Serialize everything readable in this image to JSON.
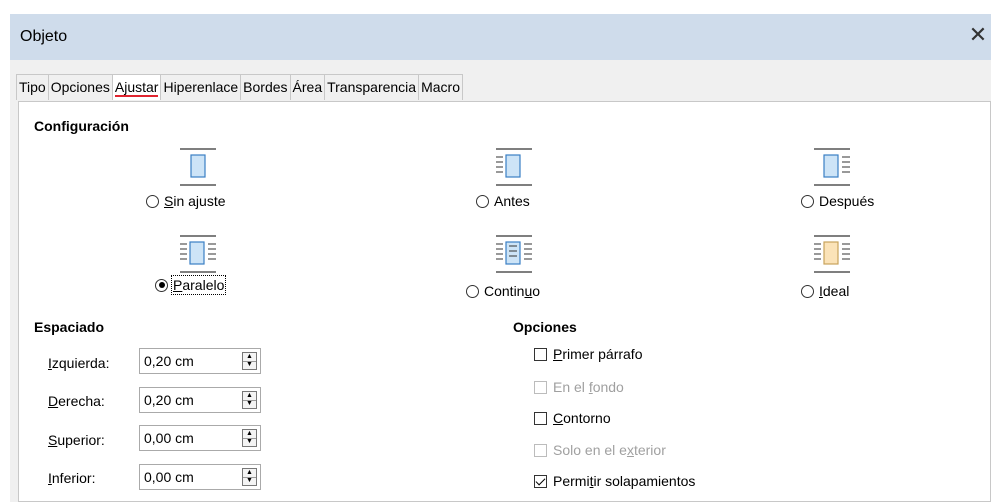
{
  "window": {
    "title": "Objeto",
    "close_glyph": "✕"
  },
  "tabs": [
    {
      "label": "Tipo",
      "active": false
    },
    {
      "label": "Opciones",
      "active": false
    },
    {
      "label": "Ajustar",
      "active": true
    },
    {
      "label": "Hiperenlace",
      "active": false
    },
    {
      "label": "Bordes",
      "active": false
    },
    {
      "label": "Área",
      "active": false
    },
    {
      "label": "Transparencia",
      "active": false
    },
    {
      "label": "Macro",
      "active": false
    }
  ],
  "configuracion": {
    "title": "Configuración",
    "options": [
      {
        "label": "Sin ajuste",
        "mnemonic": "S",
        "rest": "in ajuste",
        "checked": false,
        "icon": "wrap-none-icon"
      },
      {
        "label": "Antes",
        "checked": false,
        "icon": "wrap-before-icon"
      },
      {
        "label": "Después",
        "checked": false,
        "icon": "wrap-after-icon"
      },
      {
        "label": "Paralelo",
        "mnemonic": "P",
        "rest": "aralelo",
        "checked": true,
        "icon": "wrap-parallel-icon"
      },
      {
        "label": "Continuo",
        "pre": "Contin",
        "mnemonic": "u",
        "rest": "o",
        "checked": false,
        "icon": "wrap-through-icon"
      },
      {
        "label": "Ideal",
        "mnemonic": "I",
        "rest": "deal",
        "checked": false,
        "icon": "wrap-optimal-icon"
      }
    ]
  },
  "espaciado": {
    "title": "Espaciado",
    "fields": [
      {
        "mnemonic": "I",
        "rest": "zquierda:",
        "value": "0,20 cm"
      },
      {
        "mnemonic": "D",
        "rest": "erecha:",
        "value": "0,20 cm"
      },
      {
        "mnemonic": "S",
        "rest": "uperior:",
        "value": "0,00 cm"
      },
      {
        "mnemonic": "I",
        "rest": "nferior:",
        "value": "0,00 cm"
      }
    ]
  },
  "opciones": {
    "title": "Opciones",
    "items": [
      {
        "pre": "",
        "mnemonic": "P",
        "rest": "rimer párrafo",
        "checked": false,
        "disabled": false
      },
      {
        "pre": "En el ",
        "mnemonic": "f",
        "rest": "ondo",
        "checked": false,
        "disabled": true
      },
      {
        "pre": "",
        "mnemonic": "C",
        "rest": "ontorno",
        "checked": false,
        "disabled": false
      },
      {
        "pre": "Solo en el e",
        "mnemonic": "x",
        "rest": "terior",
        "checked": false,
        "disabled": true
      },
      {
        "pre": "Permi",
        "mnemonic": "t",
        "rest": "ir solapamientos",
        "checked": true,
        "disabled": false
      }
    ]
  },
  "colors": {
    "titlebar": "#cfdceb",
    "active_tab_underline": "#e0242f",
    "icon_fill": "#cde4f7",
    "icon_stroke": "#3a7fc4",
    "ideal_fill": "#fbe3b8"
  }
}
